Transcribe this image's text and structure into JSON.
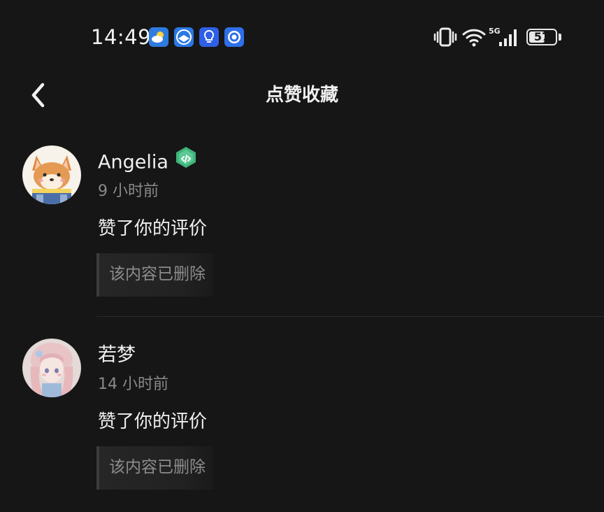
{
  "status_bar": {
    "time": "14:49",
    "network": "5G",
    "battery": "57",
    "app_icons": [
      "weather-icon",
      "browser-icon",
      "lightbulb-icon",
      "app-circle-icon"
    ]
  },
  "header": {
    "title": "点赞收藏",
    "back_icon": "chevron-left-icon"
  },
  "notifications": [
    {
      "user_name": "Angelia",
      "has_badge": true,
      "time_ago": "9 小时前",
      "action": "赞了你的评价",
      "quoted_content": "该内容已删除"
    },
    {
      "user_name": "若梦",
      "has_badge": false,
      "time_ago": "14 小时前",
      "action": "赞了你的评价",
      "quoted_content": "该内容已删除"
    }
  ],
  "colors": {
    "background": "#161616",
    "primary_text": "#f0f0f0",
    "secondary_text": "#8a8a8a",
    "badge_green": "#3fb37a"
  }
}
